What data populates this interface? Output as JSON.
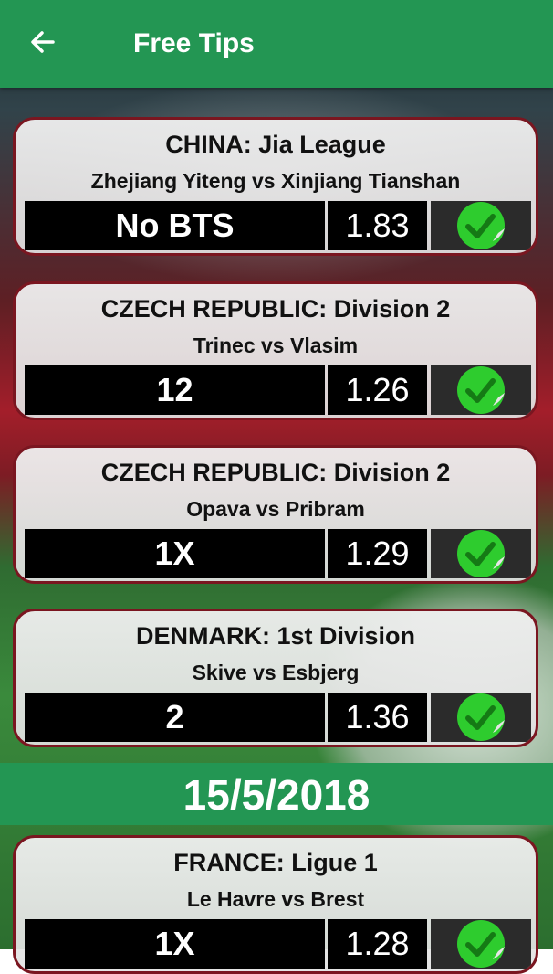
{
  "header": {
    "back_icon": "arrow-left-icon",
    "title": "Free Tips"
  },
  "colors": {
    "primary": "#239653",
    "card_border": "#7a1620",
    "check": "#2ecc2e"
  },
  "tips": [
    {
      "league": "CHINA: Jia League",
      "match": "Zhejiang Yiteng vs Xinjiang Tianshan",
      "prediction": "No BTS",
      "odds": "1.83",
      "status_icon": "check-icon"
    },
    {
      "league": "CZECH REPUBLIC: Division 2",
      "match": "Trinec vs Vlasim",
      "prediction": "12",
      "odds": "1.26",
      "status_icon": "check-icon"
    },
    {
      "league": "CZECH REPUBLIC: Division 2",
      "match": "Opava vs Pribram",
      "prediction": "1X",
      "odds": "1.29",
      "status_icon": "check-icon"
    },
    {
      "league": "DENMARK: 1st Division",
      "match": "Skive vs Esbjerg",
      "prediction": "2",
      "odds": "1.36",
      "status_icon": "check-icon"
    }
  ],
  "date_header": "15/5/2018",
  "next_tips": [
    {
      "league": "FRANCE: Ligue 1",
      "match": "Le Havre vs Brest",
      "prediction": "1X",
      "odds": "1.28",
      "status_icon": "check-icon"
    }
  ]
}
